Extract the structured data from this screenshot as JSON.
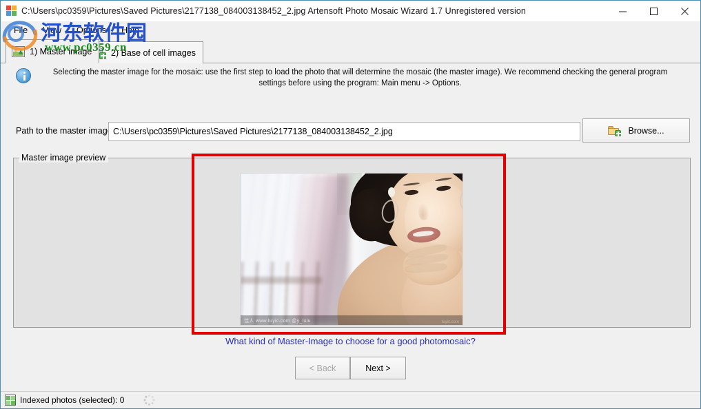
{
  "window": {
    "title": "C:\\Users\\pc0359\\Pictures\\Saved Pictures\\2177138_084003138452_2.jpg Artensoft Photo Mosaic Wizard 1.7  Unregistered version",
    "app_icon": "app-logo-icon",
    "minimize_label": "minimize-icon",
    "maximize_label": "maximize-icon",
    "close_label": "close-icon"
  },
  "menu": {
    "items": [
      {
        "label": "File"
      },
      {
        "label": "View"
      },
      {
        "label": "Options"
      },
      {
        "label": "Help"
      }
    ]
  },
  "tabs": [
    {
      "label": "1) Master image",
      "icon": "picture-icon",
      "active": true
    },
    {
      "label": "2) Base of cell images",
      "icon": "database-add-icon",
      "active": false
    }
  ],
  "info": {
    "icon": "info-icon",
    "text": "Selecting the master image for the mosaic: use the first step to load the photo that will determine the mosaic (the master image). We recommend checking the general program settings before using the program: Main menu -> Options."
  },
  "path_row": {
    "label": "Path to the master image:",
    "value": "C:\\Users\\pc0359\\Pictures\\Saved Pictures\\2177138_084003138452_2.jpg",
    "placeholder": "",
    "browse_label": "Browse...",
    "browse_icon": "folder-add-icon"
  },
  "preview": {
    "group_title": "Master image preview",
    "photo_alt": "Portrait photo of a woman with dark hair and hoop earrings resting her chin on her hand in front of a bright window with curtains",
    "photo_watermark_left": "佳人 www.tuyic.com  @y_lulu",
    "photo_watermark_right": "tuyic.com",
    "annotation_color": "#e00000"
  },
  "hint_link": {
    "text": "What kind of Master-Image to choose for a good photomosaic?",
    "color": "#2b2bbd"
  },
  "wizard_buttons": {
    "back": {
      "label": "< Back",
      "disabled": true
    },
    "next": {
      "label": "Next >",
      "disabled": false
    }
  },
  "status_bar": {
    "icon": "indexed-photos-icon",
    "text": "Indexed photos (selected): 0",
    "spinner": "loading-spinner-icon"
  },
  "site_watermark": {
    "name": "河东软件园",
    "url": "www.pc0359.cn",
    "name_color": "#2450c8",
    "url_color": "#1a8a1a"
  }
}
